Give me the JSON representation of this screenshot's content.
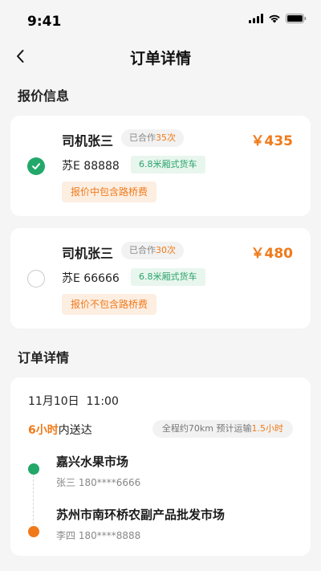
{
  "status": {
    "time": "9:41"
  },
  "nav": {
    "title": "订单详情"
  },
  "quote_section": {
    "title": "报价信息"
  },
  "quotes": [
    {
      "selected": true,
      "driver": "司机张三",
      "coop_prefix": "已合作",
      "coop_count": "35次",
      "price": "￥435",
      "plate": "苏E 88888",
      "truck_type": "6.8米厢式货车",
      "fee_note": "报价中包含路桥费"
    },
    {
      "selected": false,
      "driver": "司机张三",
      "coop_prefix": "已合作",
      "coop_count": "30次",
      "price": "￥480",
      "plate": "苏E 66666",
      "truck_type": "6.8米厢式货车",
      "fee_note": "报价不包含路桥费"
    }
  ],
  "order_section": {
    "title": "订单详情"
  },
  "order": {
    "datetime": "11月10日  11:00",
    "delivery_hours": "6小时",
    "delivery_suffix": "内送达",
    "route_prefix": "全程约70km  预计运输",
    "route_time": "1.5小时",
    "stops": [
      {
        "name": "嘉兴水果市场",
        "contact": "张三 180****6666",
        "color": "#23a86a"
      },
      {
        "name": "苏州市南环桥农副产品批发市场",
        "contact": "李四 180****8888",
        "color": "#f07a1a"
      }
    ]
  }
}
